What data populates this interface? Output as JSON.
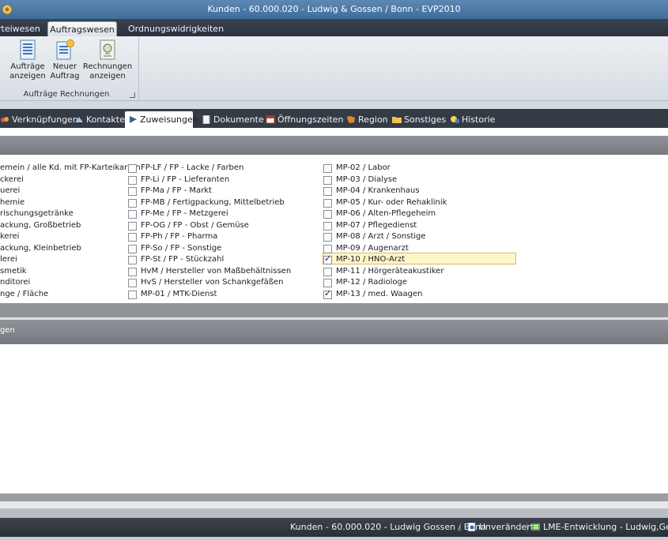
{
  "window": {
    "title": "Kunden - 60.000.020 - Ludwig & Gossen / Bonn - EVP2010"
  },
  "ribbon": {
    "tabs": [
      {
        "label": "rteiwesen",
        "active": false
      },
      {
        "label": "Auftragswesen",
        "active": true
      },
      {
        "label": "Ordnungswidrigkeiten",
        "active": false
      }
    ],
    "buttons": [
      {
        "line1": "Aufträge",
        "line2": "anzeigen",
        "icon": "document-list-icon"
      },
      {
        "line1": "Neuer",
        "line2": "Auftrag",
        "icon": "new-document-icon"
      },
      {
        "line1": "Rechnungen",
        "line2": "anzeigen",
        "icon": "invoice-icon"
      }
    ],
    "group_label": "Aufträge Rechnungen"
  },
  "tabs": [
    {
      "label": "Verknüpfungen",
      "icon": "link-icon",
      "active": false
    },
    {
      "label": "Kontakte",
      "icon": "contacts-icon",
      "active": false
    },
    {
      "label": "Zuweisungen",
      "icon": "flag-icon",
      "active": true
    },
    {
      "label": "Dokumente",
      "icon": "document-icon",
      "active": false
    },
    {
      "label": "Öffnungszeiten",
      "icon": "calendar-icon",
      "active": false
    },
    {
      "label": "Region",
      "icon": "region-icon",
      "active": false
    },
    {
      "label": "Sonstiges",
      "icon": "folder-icon",
      "active": false
    },
    {
      "label": "Historie",
      "icon": "history-icon",
      "active": false
    }
  ],
  "sections": {
    "lower_title": "gen"
  },
  "checklist": {
    "col0": [
      "emein / alle Kd. mit FP-Karteikarten",
      "ckerei",
      "uerei",
      "hemie",
      "rischungsgetränke",
      "ackung, Großbetrieb",
      "kerei",
      "ackung, Kleinbetrieb",
      "lerei",
      "smetik",
      "nditorei",
      "nge / Fläche"
    ],
    "col1": [
      {
        "label": "FP-LF / FP - Lacke / Farben",
        "checked": false
      },
      {
        "label": "FP-Li / FP - Lieferanten",
        "checked": false
      },
      {
        "label": "FP-Ma / FP - Markt",
        "checked": false
      },
      {
        "label": "FP-MB / Fertigpackung, Mittelbetrieb",
        "checked": false
      },
      {
        "label": "FP-Me / FP - Metzgerei",
        "checked": false
      },
      {
        "label": "FP-OG / FP - Obst / Gemüse",
        "checked": false
      },
      {
        "label": "FP-Ph / FP - Pharma",
        "checked": false
      },
      {
        "label": "FP-So / FP - Sonstige",
        "checked": false
      },
      {
        "label": "FP-St / FP - Stückzahl",
        "checked": false
      },
      {
        "label": "HvM / Hersteller von Maßbehältnissen",
        "checked": false
      },
      {
        "label": "HvS / Hersteller von Schankgefäßen",
        "checked": false
      },
      {
        "label": "MP-01 / MTK-Dienst",
        "checked": false
      }
    ],
    "col2": [
      {
        "label": "MP-02 / Labor",
        "checked": false
      },
      {
        "label": "MP-03 / Dialyse",
        "checked": false
      },
      {
        "label": "MP-04 / Krankenhaus",
        "checked": false
      },
      {
        "label": "MP-05 / Kur- oder Rehaklinik",
        "checked": false
      },
      {
        "label": "MP-06 / Alten-Pflegeheim",
        "checked": false
      },
      {
        "label": "MP-07 / Pflegedienst",
        "checked": false
      },
      {
        "label": "MP-08 / Arzt / Sonstige",
        "checked": false
      },
      {
        "label": "MP-09 / Augenarzt",
        "checked": false
      },
      {
        "label": "MP-10 / HNO-Arzt",
        "checked": true
      },
      {
        "label": "MP-11 / Hörgeräteakustiker",
        "checked": false
      },
      {
        "label": "MP-12 / Radiologe",
        "checked": false
      },
      {
        "label": "MP-13 / med. Waagen",
        "checked": true
      }
    ],
    "more_indicator": "····"
  },
  "statusbar": {
    "record": "Kunden - 60.000.020 - Ludwig  Gossen / Bonn",
    "state": "Unverändert",
    "environment": "LME-Entwicklung - Ludwig,Georg"
  },
  "colors": {
    "titlebar": "#4a77a6",
    "dark_strip": "#343b44",
    "section_bar": "#85898e",
    "highlight": "#fff6c8"
  }
}
